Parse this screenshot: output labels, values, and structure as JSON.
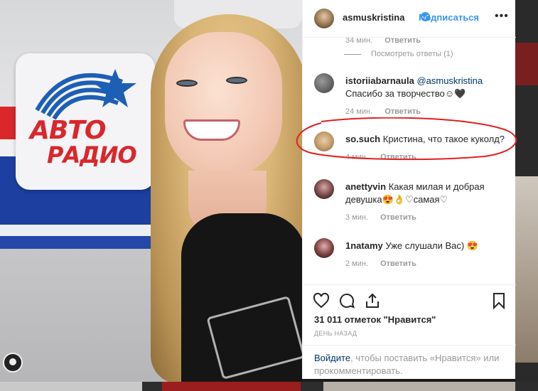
{
  "header": {
    "username": "asmuskristina",
    "follow_label": "Подписаться",
    "more_label": "•••"
  },
  "photo": {
    "logo_line1": "АВТО",
    "logo_line2": "РАДИО"
  },
  "comments_top": {
    "timestamp": "34 мин.",
    "reply_label": "Ответить",
    "view_replies": "Посмотреть ответы (1)"
  },
  "comments": [
    {
      "username": "istoriiabarnaula",
      "mention": "@asmuskristina",
      "text": "Спасибо за творчество☺🖤",
      "time": "24 мин.",
      "reply_label": "Ответить"
    },
    {
      "username": "so.such",
      "text": "Кристина, что такое куколд?",
      "time": "4 мин.",
      "reply_label": "Ответить"
    },
    {
      "username": "anettyvin",
      "text": "Какая милая и добрая девушка😍👌♡самая♡",
      "time": "3 мин.",
      "reply_label": "Ответить"
    },
    {
      "username": "1natamy",
      "text": "Уже слушали Вас) 😍",
      "time": "2 мин.",
      "reply_label": "Ответить"
    }
  ],
  "actions": {
    "likes": "31 011 отметок \"Нравится\"",
    "date": "ДЕНЬ НАЗАД"
  },
  "login": {
    "link": "Войдите",
    "text": ", чтобы поставить «Нравится» или прокомментировать."
  },
  "colors": {
    "accent": "#3897f0",
    "annotation": "#e0201f"
  }
}
